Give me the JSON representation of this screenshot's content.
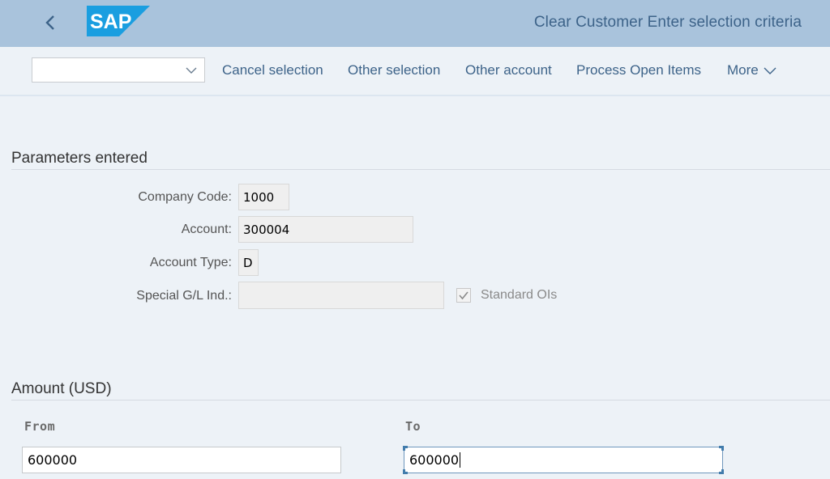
{
  "shell": {
    "back_icon": "chevron-left-icon",
    "logo_text": "SAP",
    "title": "Clear Customer Enter selection criteria",
    "colors": {
      "bar": "#a9c3dc",
      "logo": "#1a9ee0",
      "title_text": "#3d6389"
    }
  },
  "toolbar": {
    "select_value": "",
    "select_icon": "chevron-down-icon",
    "buttons": [
      {
        "label": "Cancel selection"
      },
      {
        "label": "Other selection"
      },
      {
        "label": "Other account"
      },
      {
        "label": "Process Open Items"
      },
      {
        "label": "More"
      }
    ]
  },
  "parameters": {
    "title": "Parameters entered",
    "fields": [
      {
        "label": "Company Code:",
        "value": "1000"
      },
      {
        "label": "Account:",
        "value": "300004"
      },
      {
        "label": "Account Type:",
        "value": "D"
      },
      {
        "label": "Special G/L Ind.:",
        "value": ""
      }
    ],
    "standard_ois": {
      "label": "Standard OIs",
      "checked": true
    }
  },
  "amount": {
    "title": "Amount (USD)",
    "from_label": "From",
    "from_value": "600000",
    "to_label": "To",
    "to_value": "600000"
  }
}
